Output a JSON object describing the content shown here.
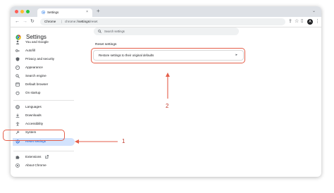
{
  "browser": {
    "tab_title": "Settings",
    "tab_close": "×",
    "new_tab": "+",
    "omnibox_chip": "Chrome",
    "omnibox_sep": "|",
    "url_prefix": "chrome://",
    "url_path": "settings",
    "url_suffix": "/reset",
    "avatar_letter": "A"
  },
  "settings": {
    "page_title": "Settings",
    "search_placeholder": "Search settings",
    "sidebar": [
      {
        "label": "You and Google",
        "icon": "person-icon"
      },
      {
        "label": "Autofill",
        "icon": "key-icon"
      },
      {
        "label": "Privacy and security",
        "icon": "shield-icon"
      },
      {
        "label": "Appearance",
        "icon": "palette-icon"
      },
      {
        "label": "Search engine",
        "icon": "search-icon"
      },
      {
        "label": "Default browser",
        "icon": "browser-icon"
      },
      {
        "label": "On startup",
        "icon": "power-icon"
      },
      {
        "label": "Languages",
        "icon": "globe-icon"
      },
      {
        "label": "Downloads",
        "icon": "download-icon"
      },
      {
        "label": "Accessibility",
        "icon": "accessibility-icon"
      },
      {
        "label": "System",
        "icon": "wrench-icon"
      },
      {
        "label": "Reset settings",
        "icon": "history-icon",
        "active": true
      },
      {
        "label": "Extensions",
        "icon": "puzzle-icon"
      },
      {
        "label": "About Chrome",
        "icon": "chrome-icon"
      }
    ],
    "section_title": "Reset settings",
    "reset_row_label": "Restore settings to their original defaults",
    "reset_row_arrow": "▸"
  },
  "annotations": {
    "callout_1": "1",
    "callout_2": "2",
    "color": "#e45e49"
  },
  "colors": {
    "active_bg": "#d3e3fd",
    "active_text": "#0b57d0"
  }
}
